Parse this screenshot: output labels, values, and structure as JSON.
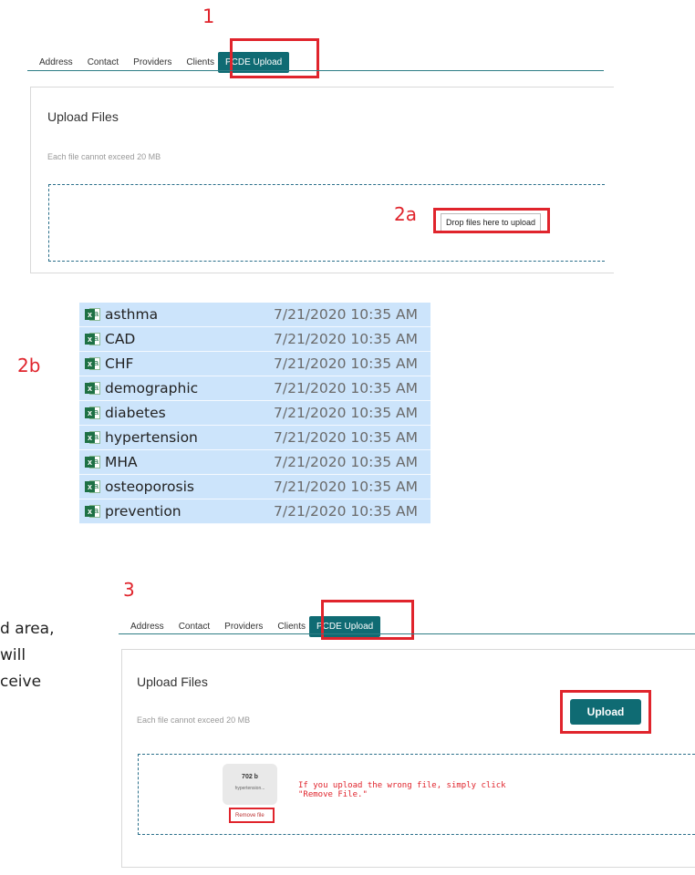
{
  "steps": {
    "s1": "1",
    "s2a": "2a",
    "s2b": "2b",
    "s3": "3"
  },
  "tabs": [
    "Address",
    "Contact",
    "Providers",
    "Clients",
    "PCDE Upload"
  ],
  "panel": {
    "title": "Upload Files",
    "subtitle": "Each file cannot exceed 20 MB",
    "drop_label": "Drop files here to upload"
  },
  "files": [
    {
      "name": "asthma",
      "date": "7/21/2020 10:35 AM"
    },
    {
      "name": "CAD",
      "date": "7/21/2020 10:35 AM"
    },
    {
      "name": "CHF",
      "date": "7/21/2020 10:35 AM"
    },
    {
      "name": "demographic",
      "date": "7/21/2020 10:35 AM"
    },
    {
      "name": "diabetes",
      "date": "7/21/2020 10:35 AM"
    },
    {
      "name": "hypertension",
      "date": "7/21/2020 10:35 AM"
    },
    {
      "name": "MHA",
      "date": "7/21/2020 10:35 AM"
    },
    {
      "name": "osteoporosis",
      "date": "7/21/2020 10:35 AM"
    },
    {
      "name": "prevention",
      "date": "7/21/2020 10:35 AM"
    }
  ],
  "side_text": [
    "d area,",
    " will",
    "ceive"
  ],
  "upload": {
    "button": "Upload",
    "preview_size": "702 b",
    "preview_name": "hypertension...",
    "remove": "Remove file",
    "hint_line1": "If you upload the wrong file, simply click",
    "hint_line2": "\"Remove File.\""
  },
  "colors": {
    "accent": "#0f6b73",
    "highlight": "#e0242c",
    "selection": "#cce4fb"
  }
}
